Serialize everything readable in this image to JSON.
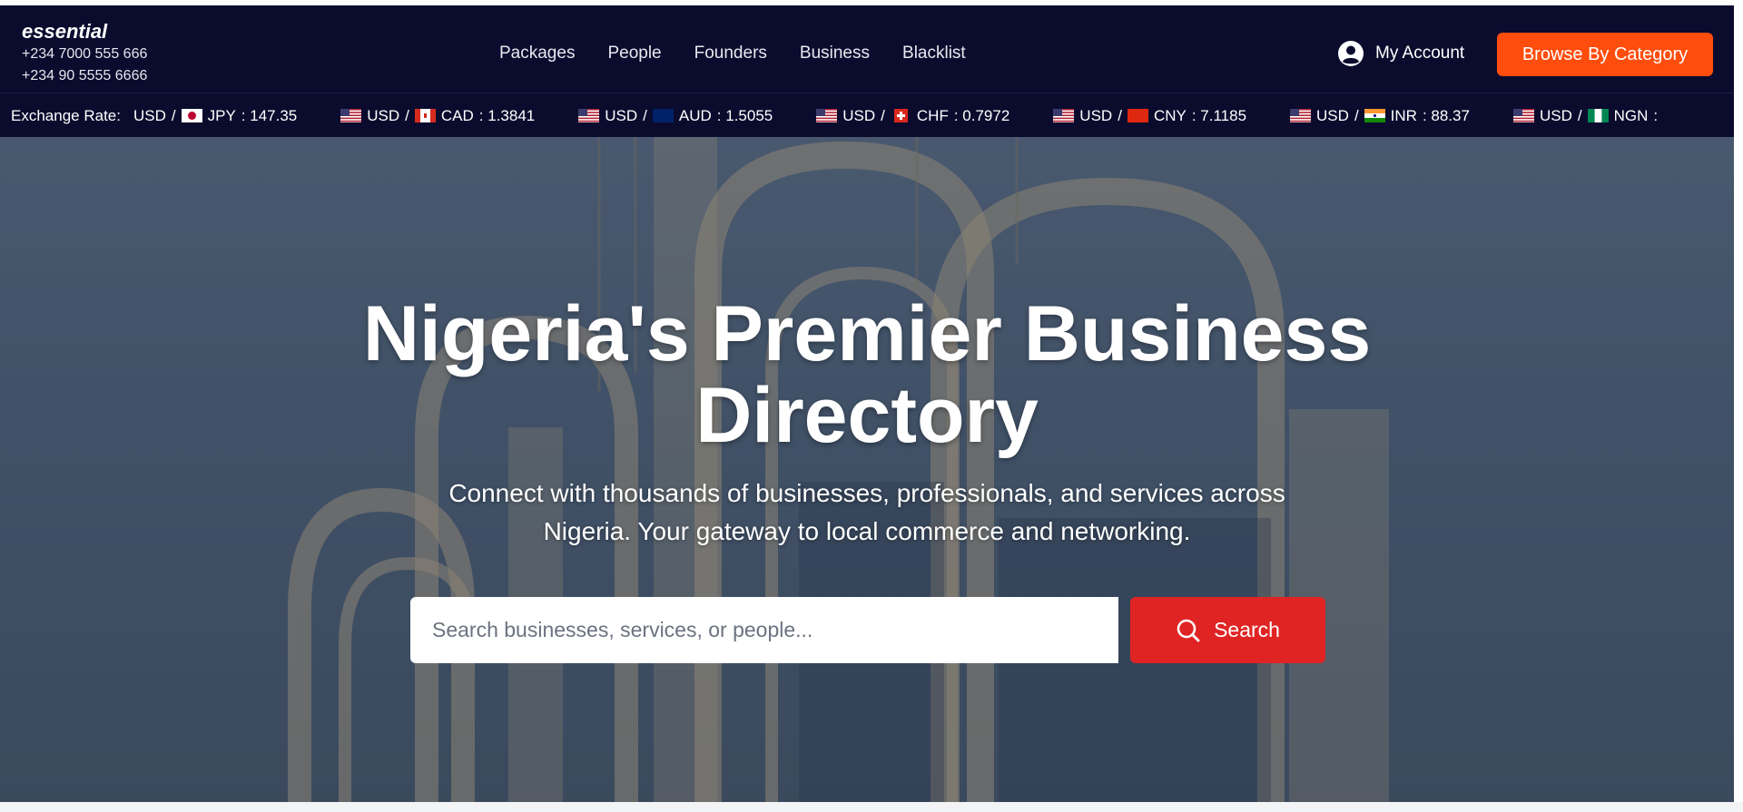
{
  "brand": {
    "logo": "essential",
    "phone1": "+234 7000 555 666",
    "phone2": "+234 90 5555 6666"
  },
  "nav": {
    "items": [
      {
        "label": "Packages"
      },
      {
        "label": "People"
      },
      {
        "label": "Founders"
      },
      {
        "label": "Business"
      },
      {
        "label": "Blacklist"
      }
    ]
  },
  "account": {
    "label": "My Account",
    "icon": "user-circle-icon"
  },
  "browse": {
    "label": "Browse By Category"
  },
  "ticker": {
    "label": "Exchange Rate:",
    "rates": [
      {
        "base": "USD",
        "sep": "/",
        "quote": "JPY",
        "value": ": 147.35",
        "show_base_flag": false
      },
      {
        "base": "USD",
        "sep": "/",
        "quote": "CAD",
        "value": ": 1.3841",
        "show_base_flag": true
      },
      {
        "base": "USD",
        "sep": "/",
        "quote": "AUD",
        "value": ": 1.5055",
        "show_base_flag": true
      },
      {
        "base": "USD",
        "sep": "/",
        "quote": "CHF",
        "value": ": 0.7972",
        "show_base_flag": true
      },
      {
        "base": "USD",
        "sep": "/",
        "quote": "CNY",
        "value": ": 7.1185",
        "show_base_flag": true
      },
      {
        "base": "USD",
        "sep": "/",
        "quote": "INR",
        "value": ": 88.37",
        "show_base_flag": true
      },
      {
        "base": "USD",
        "sep": "/",
        "quote": "NGN",
        "value": ":",
        "show_base_flag": true
      }
    ]
  },
  "hero": {
    "title_line1": "Nigeria's Premier Business",
    "title_line2": "Directory",
    "subtitle_line1": "Connect with thousands of businesses, professionals, and services across",
    "subtitle_line2": "Nigeria. Your gateway to local commerce and networking."
  },
  "search": {
    "placeholder": "Search businesses, services, or people...",
    "button_label": "Search"
  },
  "colors": {
    "header_bg": "#0b0b2e",
    "accent_orange": "#ff4d0d",
    "search_red": "#e02424"
  }
}
